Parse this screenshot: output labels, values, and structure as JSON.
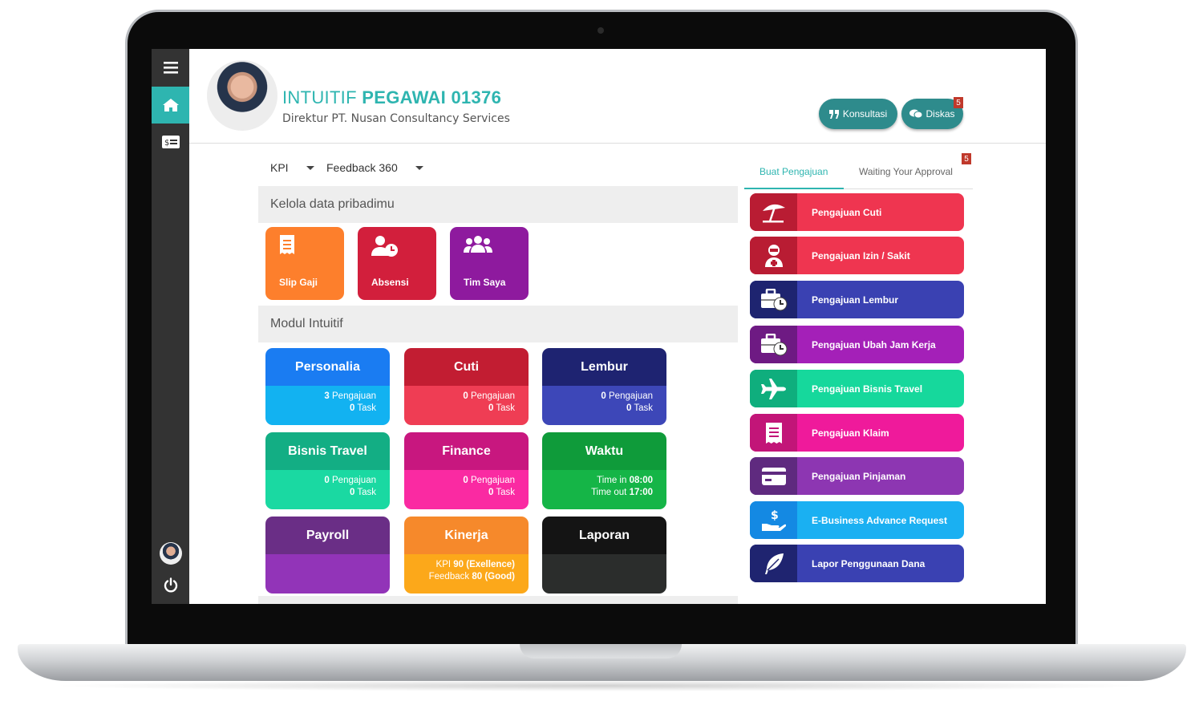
{
  "header": {
    "name_prefix": "INTUITIF",
    "name_bold": "PEGAWAI 01376",
    "subtitle": "Direktur PT. Nusan Consultancy Services",
    "konsultasi_label": "Konsultasi",
    "diskas_label": "Diskas",
    "diskas_badge": "5"
  },
  "filters": {
    "kpi": "KPI",
    "feedback": "Feedback 360"
  },
  "sections": {
    "personal": "Kelola data pribadimu",
    "modules": "Modul Intuitif"
  },
  "personal_tiles": [
    {
      "label": "Slip Gaji",
      "icon": "receipt-icon",
      "color": "#fd7f2c"
    },
    {
      "label": "Absensi",
      "icon": "user-clock-icon",
      "color": "#d21f3c"
    },
    {
      "label": "Tim Saya",
      "icon": "users-icon",
      "color": "#8e1a9e"
    }
  ],
  "modules": [
    {
      "title": "Personalia",
      "line1_val": "3",
      "line1_txt": "Pengajuan",
      "line2_val": "0",
      "line2_txt": "Task",
      "top": "#1a7cf2",
      "bot": "#12b2f1"
    },
    {
      "title": "Cuti",
      "line1_val": "0",
      "line1_txt": "Pengajuan",
      "line2_val": "0",
      "line2_txt": "Task",
      "top": "#c21d32",
      "bot": "#ef3d54"
    },
    {
      "title": "Lembur",
      "line1_val": "0",
      "line1_txt": "Pengajuan",
      "line2_val": "0",
      "line2_txt": "Task",
      "top": "#1e2371",
      "bot": "#3d47b8"
    },
    {
      "title": "Bisnis Travel",
      "line1_val": "0",
      "line1_txt": "Pengajuan",
      "line2_val": "0",
      "line2_txt": "Task",
      "top": "#13ae84",
      "bot": "#1ad9a2"
    },
    {
      "title": "Finance",
      "line1_val": "0",
      "line1_txt": "Pengajuan",
      "line2_val": "0",
      "line2_txt": "Task",
      "top": "#c8177f",
      "bot": "#fa2aa2"
    },
    {
      "title": "Waktu",
      "line1_txt": "Time in",
      "line1_val": "08:00",
      "line2_txt": "Time out",
      "line2_val": "17:00",
      "top": "#0f9b3a",
      "bot": "#15b547"
    },
    {
      "title": "Payroll",
      "top": "#6a2e86",
      "bot": "#9234b8"
    },
    {
      "title": "Kinerja",
      "line1_txt": "KPI",
      "line1_val": "90 (Exellence)",
      "line2_txt": "Feedback",
      "line2_val": "80 (Good)",
      "top": "#f6892b",
      "bot": "#fca81a"
    },
    {
      "title": "Laporan",
      "top": "#141414",
      "bot": "#2b2d2c"
    }
  ],
  "tabs": {
    "buat": "Buat Pengajuan",
    "waiting": "Waiting Your Approval",
    "waiting_badge": "5"
  },
  "requests": [
    {
      "label": "Pengajuan Cuti",
      "icon": "beach-umbrella-icon",
      "icon_bg": "#b91c33",
      "bg": "#ef3550"
    },
    {
      "label": "Pengajuan Izin / Sakit",
      "icon": "user-sick-icon",
      "icon_bg": "#b91c33",
      "bg": "#ef3550"
    },
    {
      "label": "Pengajuan Lembur",
      "icon": "briefcase-clock-icon",
      "icon_bg": "#1e2470",
      "bg": "#3a41b2"
    },
    {
      "label": "Pengajuan Ubah Jam Kerja",
      "icon": "briefcase-clock-icon",
      "icon_bg": "#6e1a83",
      "bg": "#a420b8"
    },
    {
      "label": "Pengajuan Bisnis Travel",
      "icon": "plane-icon",
      "icon_bg": "#0fae7d",
      "bg": "#16d89c"
    },
    {
      "label": "Pengajuan Klaim",
      "icon": "receipt-icon",
      "icon_bg": "#c21578",
      "bg": "#ef1a9b"
    },
    {
      "label": "Pengajuan Pinjaman",
      "icon": "credit-card-icon",
      "icon_bg": "#5f2a7f",
      "bg": "#8d36b2"
    },
    {
      "label": "E-Business Advance Request",
      "icon": "hand-dollar-icon",
      "icon_bg": "#1489e3",
      "bg": "#1ab0f2"
    },
    {
      "label": "Lapor Penggunaan Dana",
      "icon": "feather-icon",
      "icon_bg": "#1f2470",
      "bg": "#3a41b2"
    }
  ]
}
